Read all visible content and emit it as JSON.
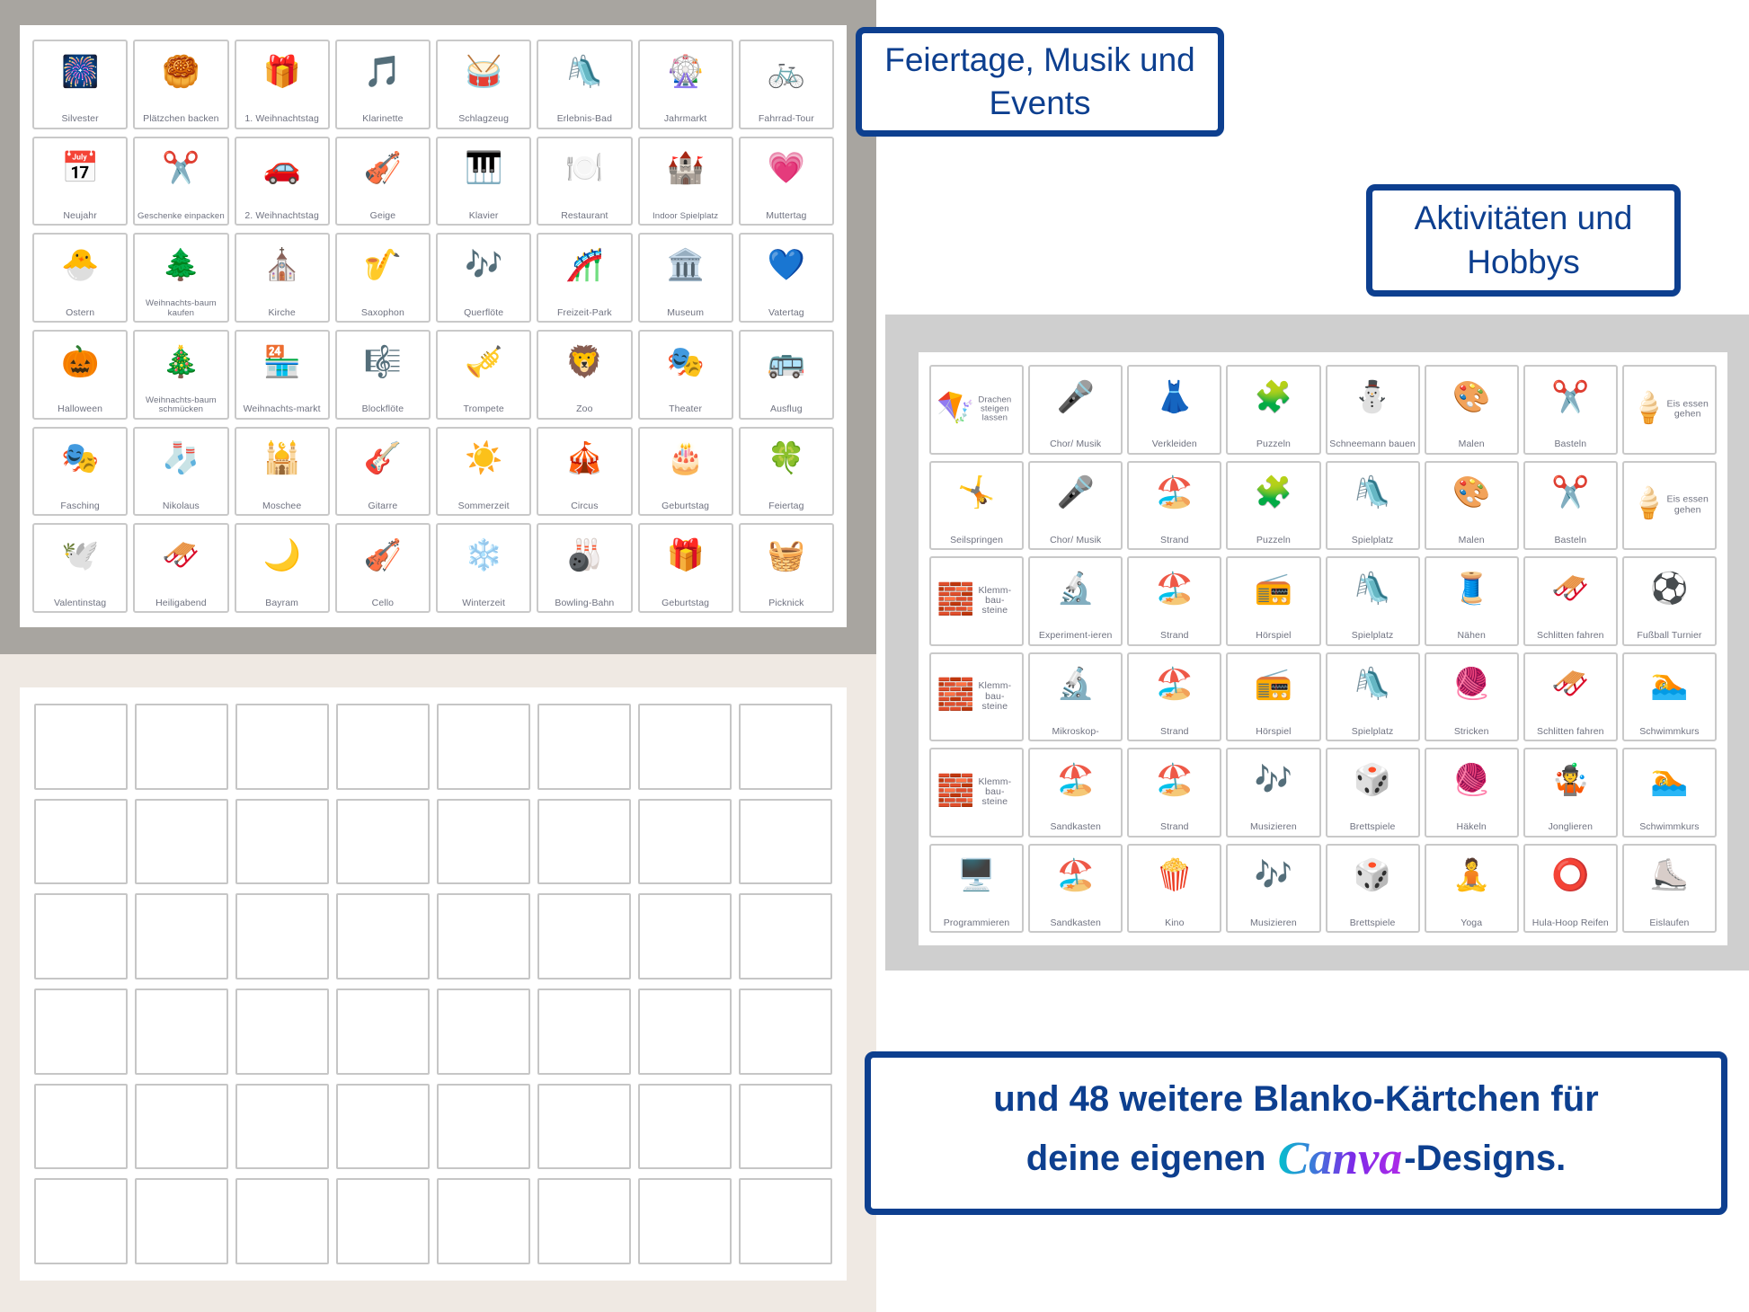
{
  "colors": {
    "accent_blue": "#0d3f8f",
    "card_border": "#c9c9c9",
    "label_text": "#6f7280",
    "bg_gray": "#a8a5a0",
    "bg_cream": "#efe9e3",
    "bg_panel_gray": "#cfcfcf",
    "canva_cyan": "#00c4cc",
    "canva_purple": "#7d2ae8"
  },
  "callouts": {
    "holidays": "Feiertage, Musik und Events",
    "activities": "Aktivitäten und Hobbys",
    "blank_line1": "und 48 weitere Blanko-Kärtchen für",
    "blank_line2_pre": "deine eigenen",
    "blank_canva": "Canva",
    "blank_line2_post": "-Designs."
  },
  "holidays_sheet": {
    "columns": 8,
    "rows": 6,
    "cards": [
      {
        "label": "Silvester",
        "icon": "fireworks-icon"
      },
      {
        "label": "Plätzchen backen",
        "icon": "cookie-dough-icon"
      },
      {
        "label": "1. Weihnachtstag",
        "icon": "gifts-icon"
      },
      {
        "label": "Klarinette",
        "icon": "clarinet-icon"
      },
      {
        "label": "Schlagzeug",
        "icon": "drums-icon"
      },
      {
        "label": "Erlebnis-Bad",
        "icon": "waterslide-icon"
      },
      {
        "label": "Jahrmarkt",
        "icon": "ferris-wheel-icon"
      },
      {
        "label": "Fahrrad-Tour",
        "icon": "bicycle-tour-icon"
      },
      {
        "label": "Neujahr",
        "icon": "calendar-jan1-icon"
      },
      {
        "label": "Geschenke einpacken",
        "icon": "scissors-ribbon-icon"
      },
      {
        "label": "2. Weihnachtstag",
        "icon": "red-car-gifts-icon"
      },
      {
        "label": "Geige",
        "icon": "violin-icon"
      },
      {
        "label": "Klavier",
        "icon": "piano-icon"
      },
      {
        "label": "Restaurant",
        "icon": "restaurant-icon"
      },
      {
        "label": "Indoor Spielplatz",
        "icon": "indoor-playground-icon"
      },
      {
        "label": "Muttertag",
        "icon": "best-mom-ever-icon"
      },
      {
        "label": "Ostern",
        "icon": "easter-nest-icon"
      },
      {
        "label": "Weihnachts-baum kaufen",
        "icon": "fir-tree-icon"
      },
      {
        "label": "Kirche",
        "icon": "church-icon"
      },
      {
        "label": "Saxophon",
        "icon": "saxophone-icon"
      },
      {
        "label": "Querflöte",
        "icon": "flute-icon"
      },
      {
        "label": "Freizeit-Park",
        "icon": "rollercoaster-icon"
      },
      {
        "label": "Museum",
        "icon": "museum-icon"
      },
      {
        "label": "Vatertag",
        "icon": "awesome-dad-icon"
      },
      {
        "label": "Halloween",
        "icon": "pumpkins-icon"
      },
      {
        "label": "Weihnachts-baum schmücken",
        "icon": "baubles-lights-icon"
      },
      {
        "label": "Weihnachts-markt",
        "icon": "christmas-market-icon"
      },
      {
        "label": "Blockflöte",
        "icon": "recorder-icon"
      },
      {
        "label": "Trompete",
        "icon": "trumpet-icon"
      },
      {
        "label": "Zoo",
        "icon": "zoo-icon"
      },
      {
        "label": "Theater",
        "icon": "theater-curtain-icon"
      },
      {
        "label": "Ausflug",
        "icon": "bus-trip-icon"
      },
      {
        "label": "Fasching",
        "icon": "carnival-mask-icon"
      },
      {
        "label": "Nikolaus",
        "icon": "stocking-icon"
      },
      {
        "label": "Moschee",
        "icon": "mosque-icon"
      },
      {
        "label": "Gitarre",
        "icon": "guitar-icon"
      },
      {
        "label": "Sommerzeit",
        "icon": "sun-clock-icon"
      },
      {
        "label": "Circus",
        "icon": "circus-tent-icon"
      },
      {
        "label": "Geburtstag",
        "icon": "birthday-cake-icon"
      },
      {
        "label": "Feiertag",
        "icon": "clover-icon"
      },
      {
        "label": "Valentinstag",
        "icon": "love-birds-icon"
      },
      {
        "label": "Heiligabend",
        "icon": "santa-sleigh-icon"
      },
      {
        "label": "Bayram",
        "icon": "crescent-moon-icon"
      },
      {
        "label": "Cello",
        "icon": "cello-icon"
      },
      {
        "label": "Winterzeit",
        "icon": "snowflake-clock-icon"
      },
      {
        "label": "Bowling-Bahn",
        "icon": "bowling-icon"
      },
      {
        "label": "Geburtstag",
        "icon": "gift-box-icon"
      },
      {
        "label": "Picknick",
        "icon": "picnic-basket-icon"
      }
    ]
  },
  "activities_sheet": {
    "columns": 8,
    "rows": 6,
    "cards": [
      {
        "label": "Drachen steigen lassen",
        "icon": "kite-icon",
        "side": true
      },
      {
        "label": "Chor/ Musik",
        "icon": "microphone-icon"
      },
      {
        "label": "Verkleiden",
        "icon": "dressup-icon"
      },
      {
        "label": "Puzzeln",
        "icon": "puzzle-icon"
      },
      {
        "label": "Schneemann bauen",
        "icon": "snowman-icon"
      },
      {
        "label": "Malen",
        "icon": "paint-box-icon"
      },
      {
        "label": "Basteln",
        "icon": "scissors-glue-icon"
      },
      {
        "label": "Eis essen gehen",
        "icon": "ice-cream-icon",
        "side": true
      },
      {
        "label": "Seilspringen",
        "icon": "jump-rope-icon"
      },
      {
        "label": "Chor/ Musik",
        "icon": "microphone-icon"
      },
      {
        "label": "Strand",
        "icon": "beach-icon"
      },
      {
        "label": "Puzzeln",
        "icon": "puzzle-icon"
      },
      {
        "label": "Spielplatz",
        "icon": "playground-icon"
      },
      {
        "label": "Malen",
        "icon": "paint-box-icon"
      },
      {
        "label": "Basteln",
        "icon": "scissors-glue-icon"
      },
      {
        "label": "Eis essen gehen",
        "icon": "ice-cream-icon",
        "side": true
      },
      {
        "label": "Klemm-bau-steine",
        "icon": "building-bricks-icon",
        "side": true
      },
      {
        "label": "Experiment-ieren",
        "icon": "experiment-icon"
      },
      {
        "label": "Strand",
        "icon": "beach-icon"
      },
      {
        "label": "Hörspiel",
        "icon": "radio-icon"
      },
      {
        "label": "Spielplatz",
        "icon": "playground-icon"
      },
      {
        "label": "Nähen",
        "icon": "sewing-machine-icon"
      },
      {
        "label": "Schlitten fahren",
        "icon": "sledding-icon"
      },
      {
        "label": "Fußball Turnier",
        "icon": "soccer-icon"
      },
      {
        "label": "Klemm-bau-steine",
        "icon": "building-bricks-icon",
        "side": true
      },
      {
        "label": "Mikroskop-",
        "icon": "microscope-icon"
      },
      {
        "label": "Strand",
        "icon": "beach-icon"
      },
      {
        "label": "Hörspiel",
        "icon": "radio-icon"
      },
      {
        "label": "Spielplatz",
        "icon": "playground-icon"
      },
      {
        "label": "Stricken",
        "icon": "knitting-icon"
      },
      {
        "label": "Schlitten fahren",
        "icon": "sledding-icon"
      },
      {
        "label": "Schwimmkurs",
        "icon": "pool-icon"
      },
      {
        "label": "Klemm-bau-steine",
        "icon": "building-bricks-icon",
        "side": true
      },
      {
        "label": "Sandkasten",
        "icon": "sandbox-icon"
      },
      {
        "label": "Strand",
        "icon": "beach-icon"
      },
      {
        "label": "Musizieren",
        "icon": "music-notes-icon"
      },
      {
        "label": "Brettspiele",
        "icon": "board-game-icon"
      },
      {
        "label": "Häkeln",
        "icon": "crochet-icon"
      },
      {
        "label": "Jonglieren",
        "icon": "juggling-icon"
      },
      {
        "label": "Schwimmkurs",
        "icon": "pool-icon"
      },
      {
        "label": "Programmieren",
        "icon": "computer-icon"
      },
      {
        "label": "Sandkasten",
        "icon": "sandbox-icon"
      },
      {
        "label": "Kino",
        "icon": "popcorn-icon"
      },
      {
        "label": "Musizieren",
        "icon": "music-notes-icon"
      },
      {
        "label": "Brettspiele",
        "icon": "board-game-icon"
      },
      {
        "label": "Yoga",
        "icon": "yoga-icon"
      },
      {
        "label": "Hula-Hoop Reifen",
        "icon": "hula-hoop-icon"
      },
      {
        "label": "Eislaufen",
        "icon": "ice-skates-icon"
      }
    ]
  },
  "blank_sheet": {
    "columns": 8,
    "rows": 6,
    "count": 48
  }
}
